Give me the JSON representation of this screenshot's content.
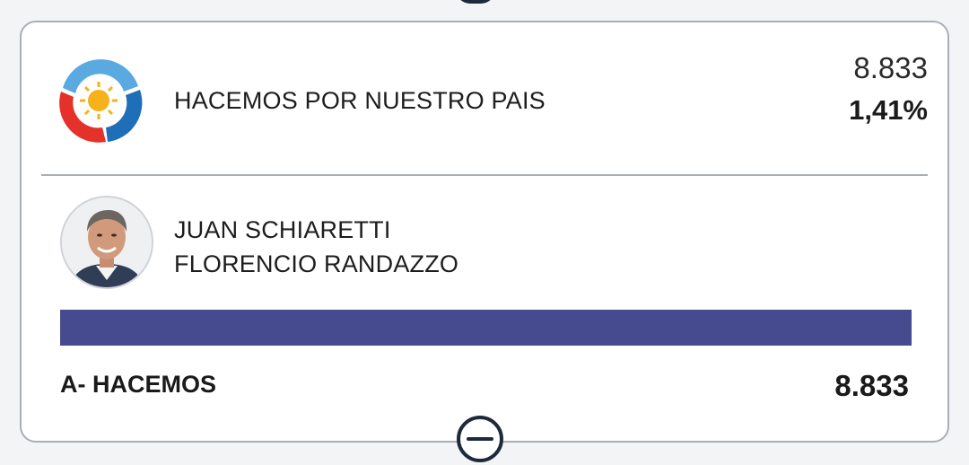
{
  "party": {
    "name": "HACEMOS POR NUESTRO PAIS",
    "votes": "8.833",
    "percent": "1,41%",
    "logo_icon": "sun-emblem-logo",
    "colors": {
      "blue": "#1f6fb8",
      "light_blue": "#5aa9e0",
      "red": "#e4322b",
      "sun": "#f6b21a"
    }
  },
  "candidate": {
    "names": [
      "JUAN SCHIARETTI",
      "FLORENCIO RANDAZZO"
    ],
    "avatar_icon": "candidate-photo"
  },
  "list": {
    "label": "A- HACEMOS",
    "votes": "8.833",
    "bar_fraction": 1.0,
    "bar_color": "#464b8f"
  },
  "controls": {
    "collapse_icon": "minus-circle-icon"
  }
}
